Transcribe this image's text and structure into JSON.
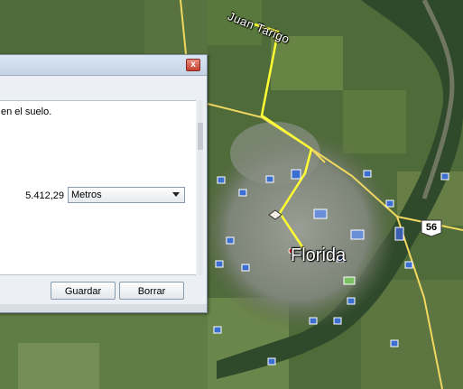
{
  "map": {
    "city_label": "Florida",
    "town_label": "Juan Tarigo",
    "route_shield": "56"
  },
  "dialog": {
    "close_glyph": "x",
    "info_text": "en el suelo.",
    "distance_value": "5.412,29",
    "unit_select": "Metros",
    "save_label": "Guardar",
    "clear_label": "Borrar"
  },
  "colors": {
    "measure_path": "#ffff33",
    "roads": "#f0d860"
  }
}
